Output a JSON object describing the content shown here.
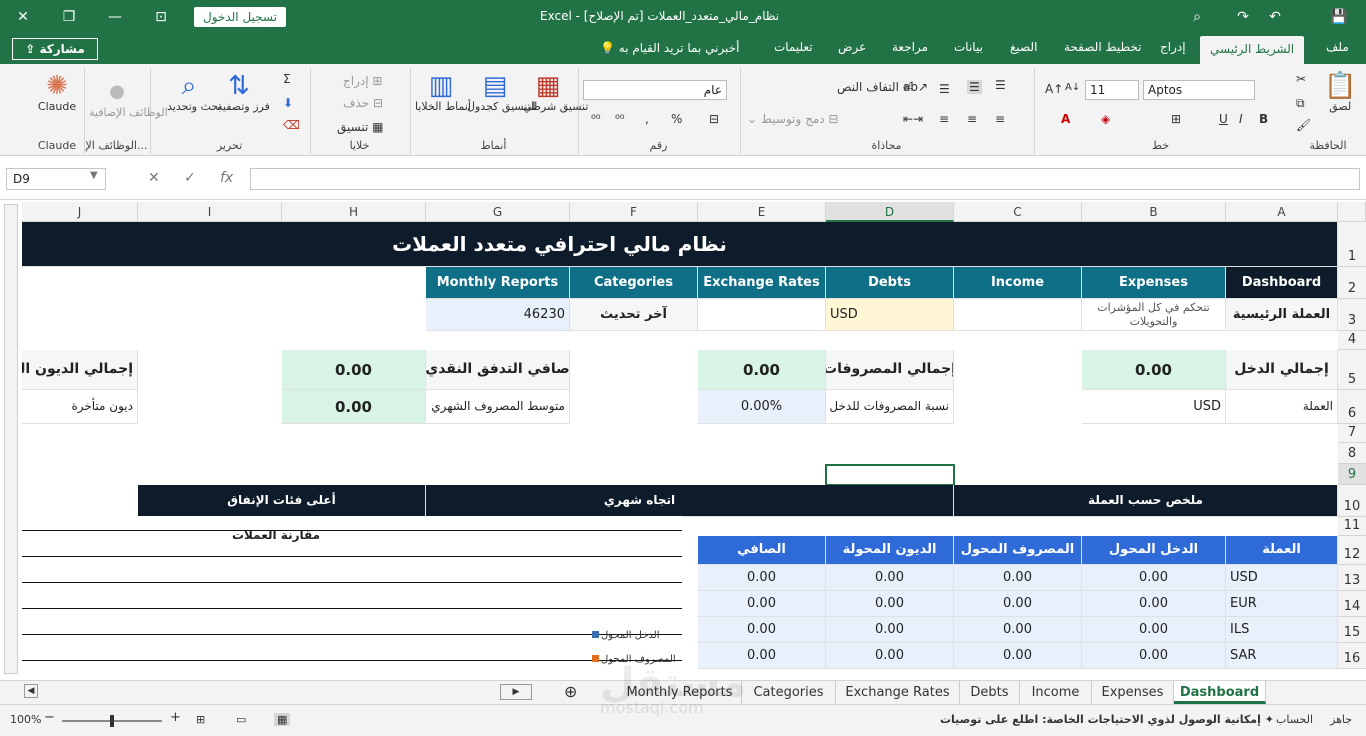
{
  "window": {
    "app": "Excel",
    "title": "نظام_مالي_متعدد_العملات  [تم الإصلاح]",
    "signin_label": "تسجيل الدخول"
  },
  "ribbon_tabs": {
    "share": "مشاركة",
    "tell_me": "أخبرني بما تريد القيام به",
    "items": [
      "ملف",
      "الشريط الرئيسي",
      "إدراج",
      "تخطيط الصفحة",
      "الصيغ",
      "بيانات",
      "مراجعة",
      "عرض",
      "تعليمات"
    ]
  },
  "ribbon": {
    "groups": {
      "clipboard": "الحافظة",
      "font": "خط",
      "alignment": "محاذاة",
      "number": "رقم",
      "styles": "أنماط",
      "cells": "خلايا",
      "editing": "تحرير",
      "addins": "الوظائف الإ...",
      "claude": "Claude"
    },
    "paste": "لصق",
    "font_name": "Aptos",
    "font_size": "11",
    "wrap_text": "التفاف النص",
    "merge_center": "دمج وتوسيط",
    "number_format": "عام",
    "conditional_formatting": "تنسيق شرطي",
    "format_as_table": "التنسيق كجدول",
    "cell_styles": "أنماط الخلايا",
    "insert": "إدراج",
    "delete": "حذف",
    "format": "تنسيق",
    "sort_filter": "فرز وتصفية",
    "find_select": "بحث وتحديد",
    "addins_btn": "الوظائف الإضافية",
    "claude_btn": "Claude"
  },
  "formula_bar": {
    "name_box": "D9",
    "formula": ""
  },
  "columns": [
    "A",
    "B",
    "C",
    "D",
    "E",
    "F",
    "G",
    "H",
    "I",
    "J"
  ],
  "rows": [
    "1",
    "2",
    "3",
    "4",
    "5",
    "6",
    "7",
    "8",
    "9",
    "10",
    "11",
    "12",
    "13",
    "14",
    "15",
    "16"
  ],
  "sheet": {
    "title": "نظام مالي احترافي متعدد العملات",
    "nav": [
      "Dashboard",
      "Expenses",
      "Income",
      "Debts",
      "Exchange Rates",
      "Categories",
      "Monthly Reports"
    ],
    "main_currency_label": "العملة الرئيسية",
    "control_text": "تتحكم في كل المؤشرات والتحويلات",
    "main_currency": "USD",
    "last_update_label": "آخر تحديث",
    "last_update_value": "46230",
    "kpi": {
      "total_income_label": "إجمالي الدخل",
      "total_income": "0.00",
      "total_expenses_label": "إجمالي المصروفات",
      "total_expenses": "0.00",
      "net_cashflow_label": "صافي التدفق النقدي",
      "net_cashflow": "0.00",
      "total_debts_label": "إجمالي الديون المتبقية",
      "currency_label": "العملة",
      "currency_value": "USD",
      "expense_ratio_label": "نسبة المصروفات للدخل",
      "expense_ratio": "0.00%",
      "avg_monthly_label": "متوسط المصروف الشهري",
      "avg_monthly": "0.00",
      "overdue_label": "ديون متأخرة"
    },
    "section_headers": {
      "currency_summary": "ملخص حسب العملة",
      "monthly_trend": "اتجاه شهري",
      "top_categories": "أعلى فئات الإنفاق"
    },
    "summary_table": {
      "headers": [
        "العملة",
        "الدخل المحول",
        "المصروف المحول",
        "الديون المحولة",
        "الصافي"
      ],
      "rows": [
        [
          "USD",
          "0.00",
          "0.00",
          "0.00",
          "0.00"
        ],
        [
          "EUR",
          "0.00",
          "0.00",
          "0.00",
          "0.00"
        ],
        [
          "ILS",
          "0.00",
          "0.00",
          "0.00",
          "0.00"
        ],
        [
          "SAR",
          "0.00",
          "0.00",
          "0.00",
          "0.00"
        ]
      ]
    },
    "chart": {
      "title": "مقارنة العملات",
      "legend": [
        {
          "name": "الدخل المحول",
          "color": "#3a6fb0"
        },
        {
          "name": "المصروف المحول",
          "color": "#e0701e"
        }
      ]
    }
  },
  "sheet_tabs": {
    "items": [
      "Monthly Reports",
      "Categories",
      "Exchange Rates",
      "Debts",
      "Income",
      "Expenses",
      "Dashboard"
    ],
    "active": "Dashboard"
  },
  "status": {
    "ready": "جاهز",
    "calculate": "الحساب",
    "accessibility": "إمكانية الوصول لذوي الاحتياجات الخاصة: اطلع على توصيات",
    "zoom": "100%"
  },
  "watermark": {
    "brand": "مستقل",
    "url": "mostaql.com"
  },
  "colors": {
    "excel_green": "#217346",
    "teal": "#0e6f86",
    "navy": "#0d1b2a",
    "mint": "#d8f4e4",
    "table_blue": "#2f6bd8"
  }
}
